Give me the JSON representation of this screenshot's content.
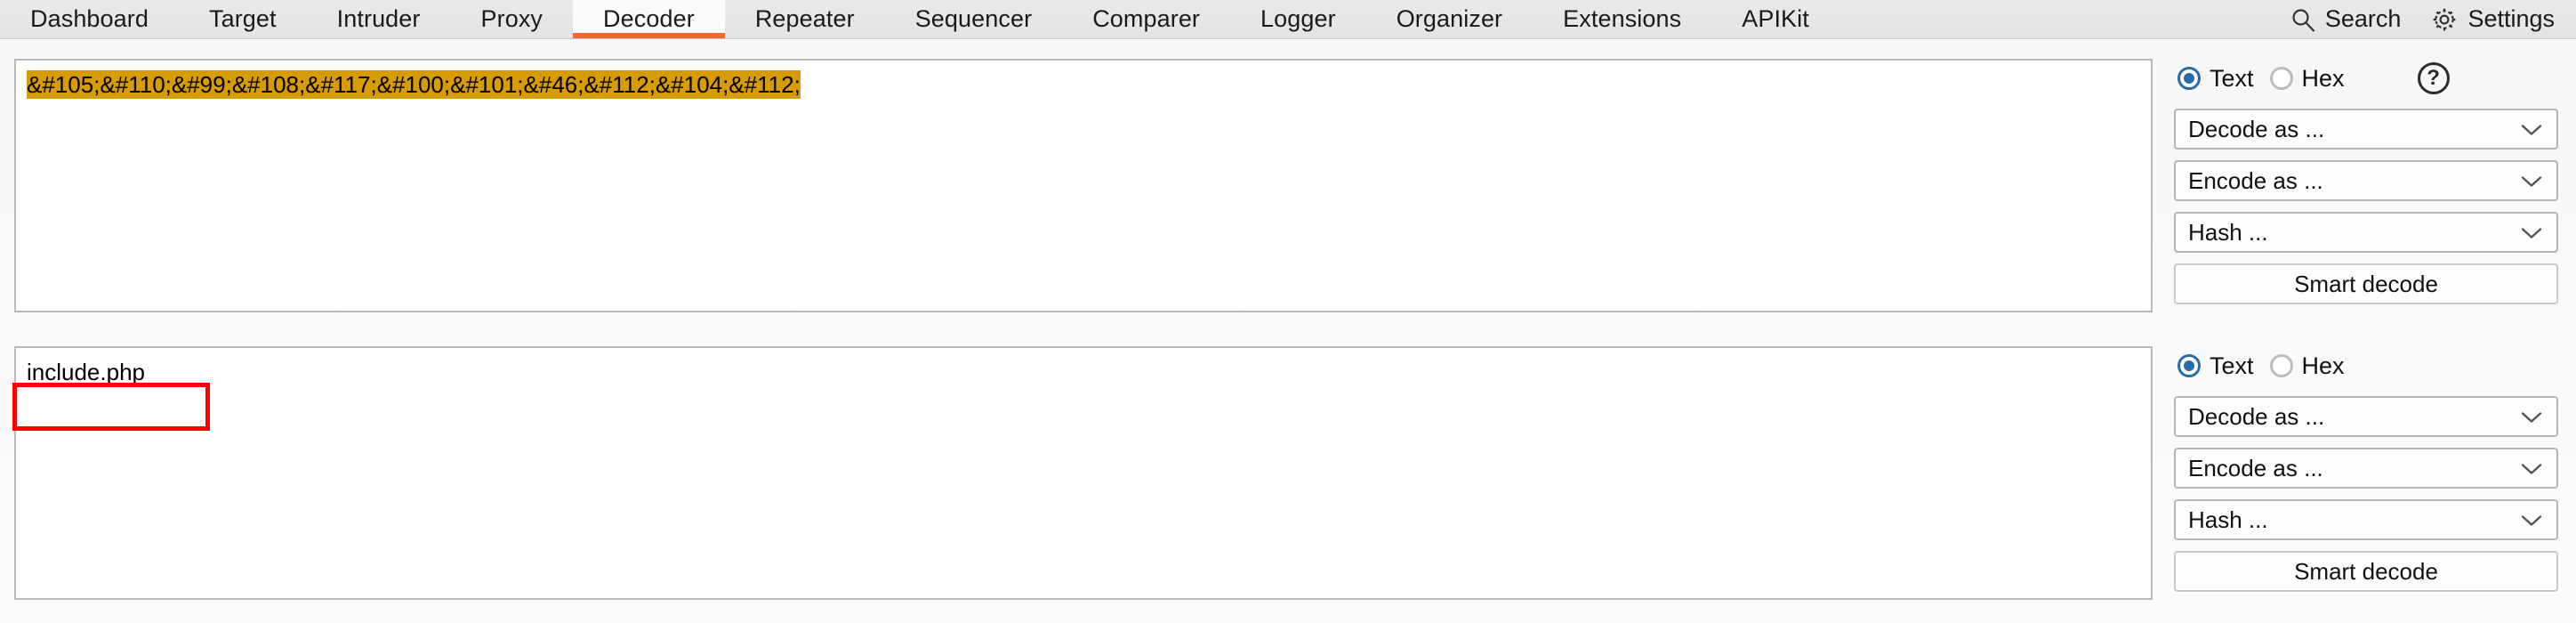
{
  "tabs": [
    {
      "label": "Dashboard",
      "active": false
    },
    {
      "label": "Target",
      "active": false
    },
    {
      "label": "Intruder",
      "active": false
    },
    {
      "label": "Proxy",
      "active": false
    },
    {
      "label": "Decoder",
      "active": true
    },
    {
      "label": "Repeater",
      "active": false
    },
    {
      "label": "Sequencer",
      "active": false
    },
    {
      "label": "Comparer",
      "active": false
    },
    {
      "label": "Logger",
      "active": false
    },
    {
      "label": "Organizer",
      "active": false
    },
    {
      "label": "Extensions",
      "active": false
    },
    {
      "label": "APIKit",
      "active": false
    }
  ],
  "right_actions": {
    "search_label": "Search",
    "search_icon": "search-icon",
    "settings_label": "Settings",
    "settings_icon": "gear-icon"
  },
  "input_panel": {
    "text": "&#105;&#110;&#99;&#108;&#117;&#100;&#101;&#46;&#112;&#104;&#112;",
    "highlighted": true,
    "highlight_color": "#d79b06",
    "controls": {
      "radio_text_label": "Text",
      "radio_hex_label": "Hex",
      "selected_radio": "Text",
      "help_label": "?",
      "decode_as_label": "Decode as ...",
      "encode_as_label": "Encode as ...",
      "hash_label": "Hash ...",
      "smart_decode_label": "Smart decode"
    }
  },
  "output_panel": {
    "text": "include.php",
    "annotation": {
      "color": "#ff0000",
      "shape": "rectangle"
    },
    "controls": {
      "radio_text_label": "Text",
      "radio_hex_label": "Hex",
      "selected_radio": "Text",
      "decode_as_label": "Decode as ...",
      "encode_as_label": "Encode as ...",
      "hash_label": "Hash ...",
      "smart_decode_label": "Smart decode"
    }
  },
  "colors": {
    "accent_orange": "#f26a32",
    "radio_blue": "#2a6ca8",
    "highlight": "#d79b06",
    "annotation_red": "#ff0000"
  }
}
